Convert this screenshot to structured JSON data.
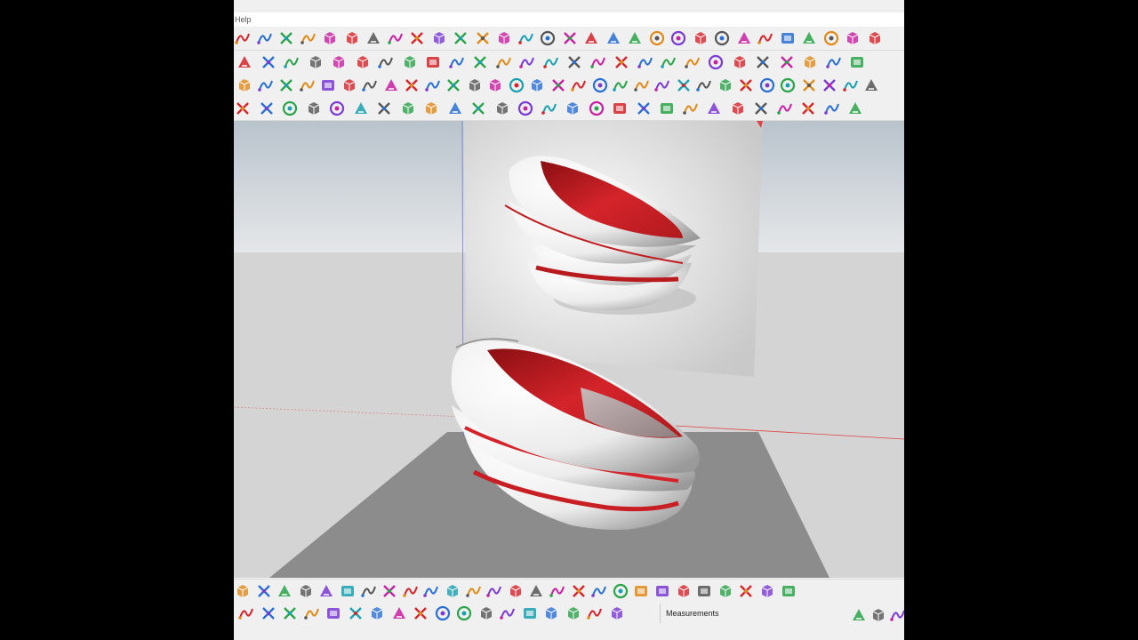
{
  "menubar": {
    "help_label": "Help"
  },
  "status": {
    "measurements_label": "Measurements"
  },
  "colors": {
    "accent_red": "#d4242a",
    "ui_bg": "#f0f0f0",
    "ground": "#8c8c8c",
    "sky": "#d4d4d4"
  },
  "toolbar_rows": [
    {
      "name": "toolbar-row-1",
      "icons": [
        "undo-icon",
        "model-info-icon",
        "tape-measure-icon",
        "text-icon",
        "paint-icon",
        "orbit-icon",
        "pan-icon",
        "zoom-icon",
        "zoom-extents-icon",
        "scene-icon",
        "layers-icon",
        "layers-stack-icon",
        "style-icon",
        "user-icon",
        "dropdown-icon",
        "shield-icon",
        "component-icon",
        "warehouse-icon",
        "box-stack-icon",
        "box-stack-blue-icon",
        "box-stack-dark-icon",
        "solid-tools-icon",
        "axis-red-icon",
        "axis-dark-icon",
        "axis-green-icon",
        "axis-red-down-icon",
        "axis-green-down-icon",
        "axis-blue-down-icon",
        "axis-orange-icon",
        "axis-purple-icon"
      ]
    },
    {
      "name": "toolbar-row-2",
      "icons": [
        "arc-icon",
        "bezier-icon",
        "line-icon",
        "lines-icon",
        "ruler-icon",
        "tools-icon",
        "gear-icon",
        "globe-icon",
        "sliders-icon",
        "help-icon",
        "record-icon",
        "stop-icon",
        "color-cube-icon",
        "move-icon",
        "pencil-icon",
        "flip-icon",
        "rotate-icon",
        "paintbrush-icon",
        "ruler-tool-icon",
        "wood-icon",
        "material-icon",
        "bevel-icon",
        "eraser-icon",
        "extend-icon",
        "scale-icon",
        "crop-icon",
        "section-icon"
      ]
    },
    {
      "name": "toolbar-row-3",
      "icons": [
        "shape-icon",
        "lock-icon",
        "camera-icon",
        "cube-icon",
        "cube-selected-icon",
        "grass-icon",
        "leaf-icon",
        "box-icon",
        "window-icon",
        "grid-icon",
        "layout-icon",
        "split-icon",
        "robot-icon",
        "gear-box-icon",
        "shade-icon",
        "sphere-icon",
        "ring-icon",
        "triangle-icon",
        "lamp-icon",
        "dome-icon",
        "disc-icon",
        "paint-bucket-icon",
        "copy-icon",
        "frame-icon",
        "cube-outline-icon",
        "cube-outline-2-icon",
        "cube-outline-3-icon",
        "chrome-icon",
        "disc-2-icon",
        "hand-icon",
        "pie-icon"
      ]
    },
    {
      "name": "toolbar-row-4",
      "icons": [
        "select-icon",
        "frame-select-icon",
        "frame-select-2-icon",
        "check-icon",
        "arc-tool-icon",
        "pin-icon",
        "spline-icon",
        "curve-icon",
        "arc-2-icon",
        "rectangle-icon",
        "circle-icon",
        "arc-3-icon",
        "freehand-icon",
        "bend-icon",
        "arc-4-icon",
        "polyline-icon",
        "polygon-icon",
        "wrench-icon",
        "ellipse-icon",
        "arrow-left-icon",
        "line-star-icon",
        "line-star-2-icon",
        "stairs-icon",
        "cube-color-icon",
        "render-icon",
        "path-icon",
        "frame-red-icon"
      ]
    }
  ],
  "bottom_rows": [
    {
      "name": "bottom-toolbar-1",
      "icons": [
        "shape-icon",
        "rotate-icon",
        "cut-icon",
        "lines-icon",
        "box-icon",
        "measure-icon",
        "tape-icon",
        "spline-icon",
        "dots-icon",
        "plus-icon",
        "cross-icon",
        "grid-icon",
        "cone-icon",
        "flask-icon",
        "sun-icon",
        "loop-icon",
        "loop-2-icon",
        "star-icon",
        "cylinder-icon",
        "arrow-u-icon",
        "network-icon",
        "nodes-icon",
        "nodes-2-icon",
        "badge-icon",
        "bricks-icon",
        "truss-icon",
        "truss-2-icon"
      ]
    },
    {
      "name": "bottom-toolbar-2",
      "icons": [
        "cube-icon",
        "spiral-icon",
        "cursor-icon",
        "move-icon",
        "refresh-icon",
        "resize-icon",
        "ruler-icon",
        "hex-icon",
        "sphere-green-icon",
        "sphere-green-2-icon",
        "sphere-green-3-icon",
        "sphere-pink-icon",
        "sphere-red-icon",
        "sphere-shadow-icon",
        "santa-icon",
        "cursor-blue-icon",
        "globe-blue-icon",
        "half-sphere-icon"
      ]
    }
  ]
}
